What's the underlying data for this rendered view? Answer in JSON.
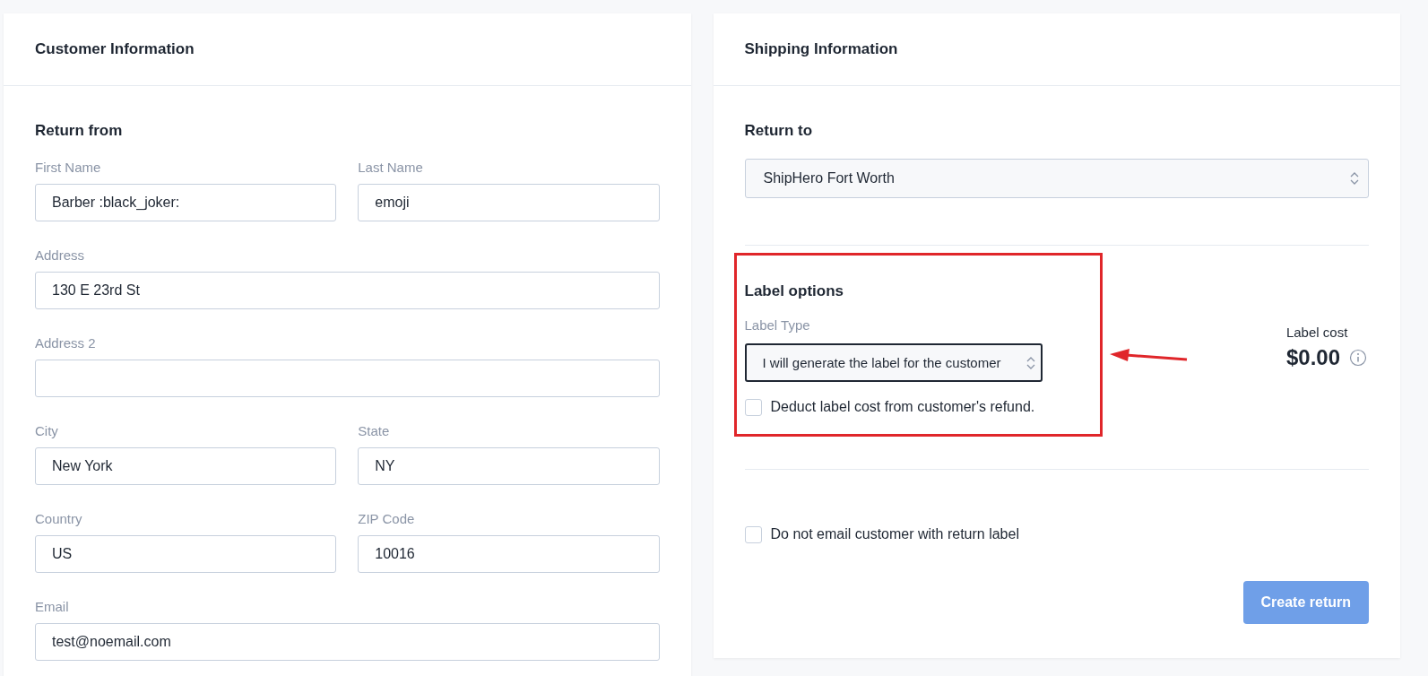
{
  "customer_card": {
    "title": "Customer Information",
    "section": "Return from",
    "rows": [
      [
        {
          "label": "First Name",
          "value": "Barber :black_joker:"
        },
        {
          "label": "Last Name",
          "value": "emoji"
        }
      ],
      [
        {
          "label": "Address",
          "value": "130 E 23rd St"
        }
      ],
      [
        {
          "label": "Address 2"
        }
      ],
      [
        {
          "label": "City",
          "value": "New York"
        },
        {
          "label": "State",
          "value": "NY"
        }
      ],
      [
        {
          "label": "Country",
          "value": "US"
        },
        {
          "label": "ZIP Code",
          "value": "10016"
        }
      ],
      [
        {
          "label": "Email",
          "value": "test@noemail.com"
        }
      ]
    ]
  },
  "shipping_card": {
    "title": "Shipping Information",
    "section": "Return to",
    "return_to": "ShipHero Fort Worth",
    "label_options": {
      "title": "Label options",
      "type_label": "Label Type",
      "type_value": "I will generate the label for the customer",
      "deduct": {
        "label": "Deduct label cost from customer's refund.",
        "checked": false
      }
    },
    "label_cost": {
      "label": "Label cost",
      "value": "$0.00"
    },
    "no_email": {
      "label": "Do not email customer with return label",
      "checked": false
    },
    "create_button": {
      "label": "Create return",
      "disabled": true
    }
  }
}
